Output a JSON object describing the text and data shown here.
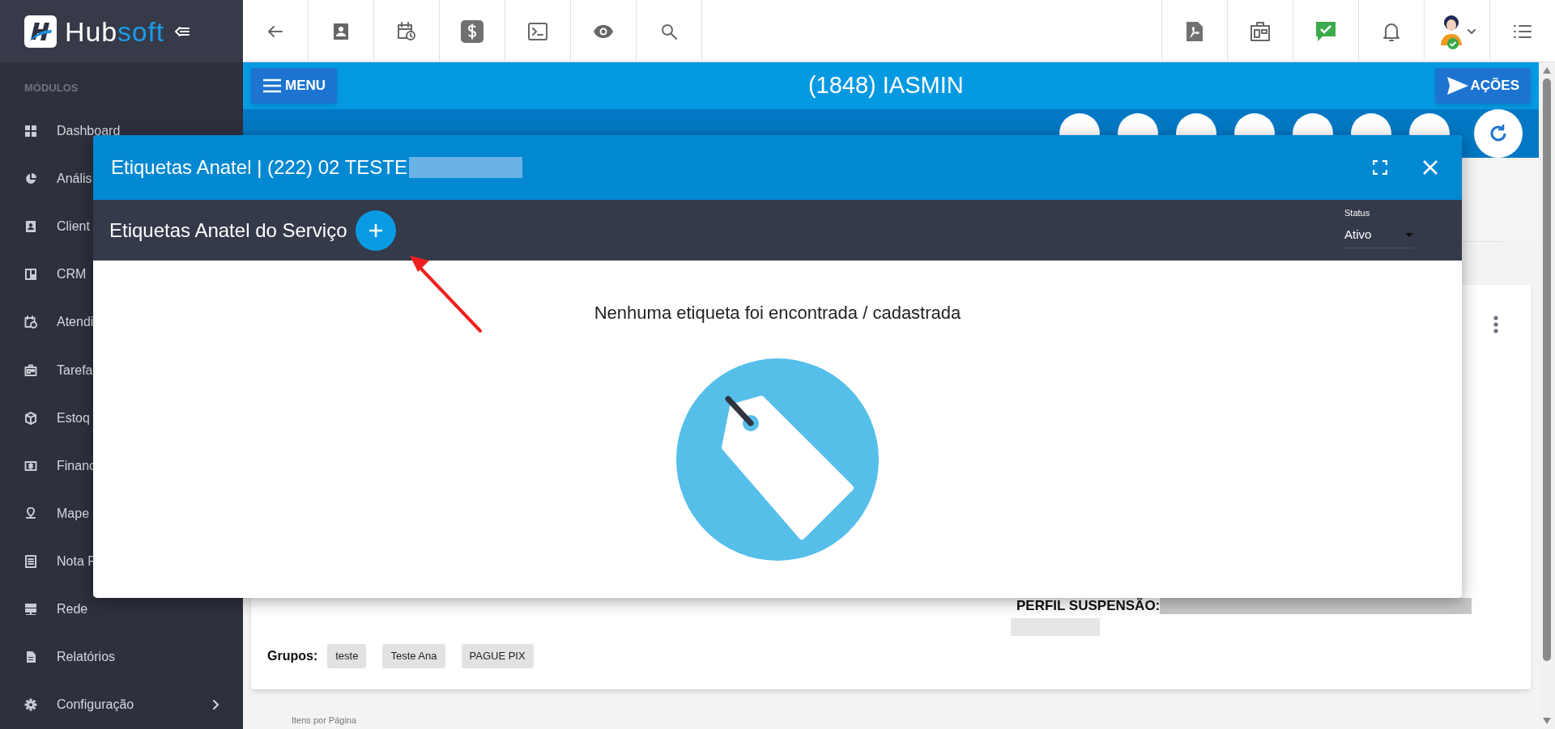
{
  "logo": {
    "first": "Hub",
    "second": "soft"
  },
  "sidebar": {
    "heading": "MÓDULOS",
    "items": [
      {
        "label": "Dashboard",
        "kind": "link"
      },
      {
        "label": "Anális",
        "kind": "link"
      },
      {
        "label": "Client",
        "kind": "link"
      },
      {
        "label": "CRM",
        "kind": "link"
      },
      {
        "label": "Atendi",
        "kind": "link"
      },
      {
        "label": "Tarefa",
        "kind": "link"
      },
      {
        "label": "Estoq",
        "kind": "link"
      },
      {
        "label": "Financ",
        "kind": "link"
      },
      {
        "label": "Mape",
        "kind": "link"
      },
      {
        "label": "Nota F",
        "kind": "link"
      },
      {
        "label": "Rede",
        "kind": "link"
      },
      {
        "label": "Relatórios",
        "kind": "link"
      },
      {
        "label": "Configuração",
        "kind": "submenu"
      }
    ]
  },
  "header": {
    "menu_button": "MENU",
    "title": "(1848) IASMIN",
    "actions_button": "AÇÕES"
  },
  "modal": {
    "title": "Etiquetas Anatel | (222) 02 TESTE",
    "subtitle": "Etiquetas Anatel do Serviço",
    "status_filter": {
      "label": "Status",
      "value": "Ativo"
    },
    "empty_message": "Nenhuma etiqueta foi encontrada / cadastrada"
  },
  "card": {
    "suspension_label": "PERFIL SUSPENSÃO:",
    "groups_label": "Grupos:",
    "groups": [
      "teste",
      "Teste Ana",
      "PAGUE PIX"
    ]
  },
  "pagination": {
    "items_per_page_label": "Itens por Página"
  }
}
